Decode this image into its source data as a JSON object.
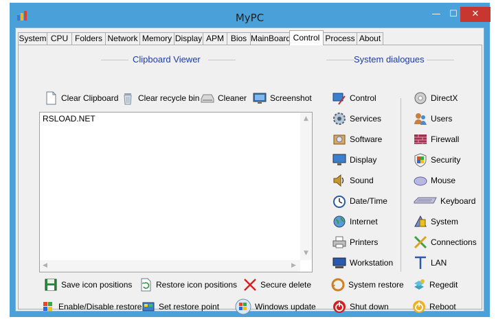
{
  "window": {
    "title": "MyPC",
    "minimize": "—",
    "maximize": "☐",
    "close": "✕"
  },
  "tabs": [
    "System",
    "CPU",
    "Folders",
    "Network",
    "Memory",
    "Display",
    "APM",
    "Bios",
    "MainBoard",
    "Control",
    "Process",
    "About"
  ],
  "active_tab": "Control",
  "clipboard": {
    "title": "Clipboard Viewer",
    "clear_clipboard": "Clear Clipboard",
    "clear_recycle": "Clear recycle bin",
    "cleaner": "Cleaner",
    "screenshot": "Screenshot",
    "content": "RSLOAD.NET"
  },
  "bottom": {
    "save_icons": "Save icon positions",
    "restore_icons": "Restore icon positions",
    "secure_delete": "Secure delete",
    "enable_restore": "Enable/Disable restore",
    "set_restore": "Set restore point",
    "windows_update": "Windows update"
  },
  "dialogs": {
    "title": "System dialogues",
    "left": [
      "Control",
      "Services",
      "Software",
      "Display",
      "Sound",
      "Date/Time",
      "Internet",
      "Printers",
      "Workstation"
    ],
    "right": [
      "DirectX",
      "Users",
      "Firewall",
      "Security",
      "Mouse",
      "Keyboard",
      "System",
      "Connections",
      "LAN"
    ],
    "system_restore": "System restore",
    "regedit": "Regedit",
    "shutdown": "Shut down",
    "reboot": "Reboot"
  },
  "colors": {
    "frame": "#4aa0d8",
    "close": "#c7372f",
    "group_title": "#1a3c9e"
  }
}
